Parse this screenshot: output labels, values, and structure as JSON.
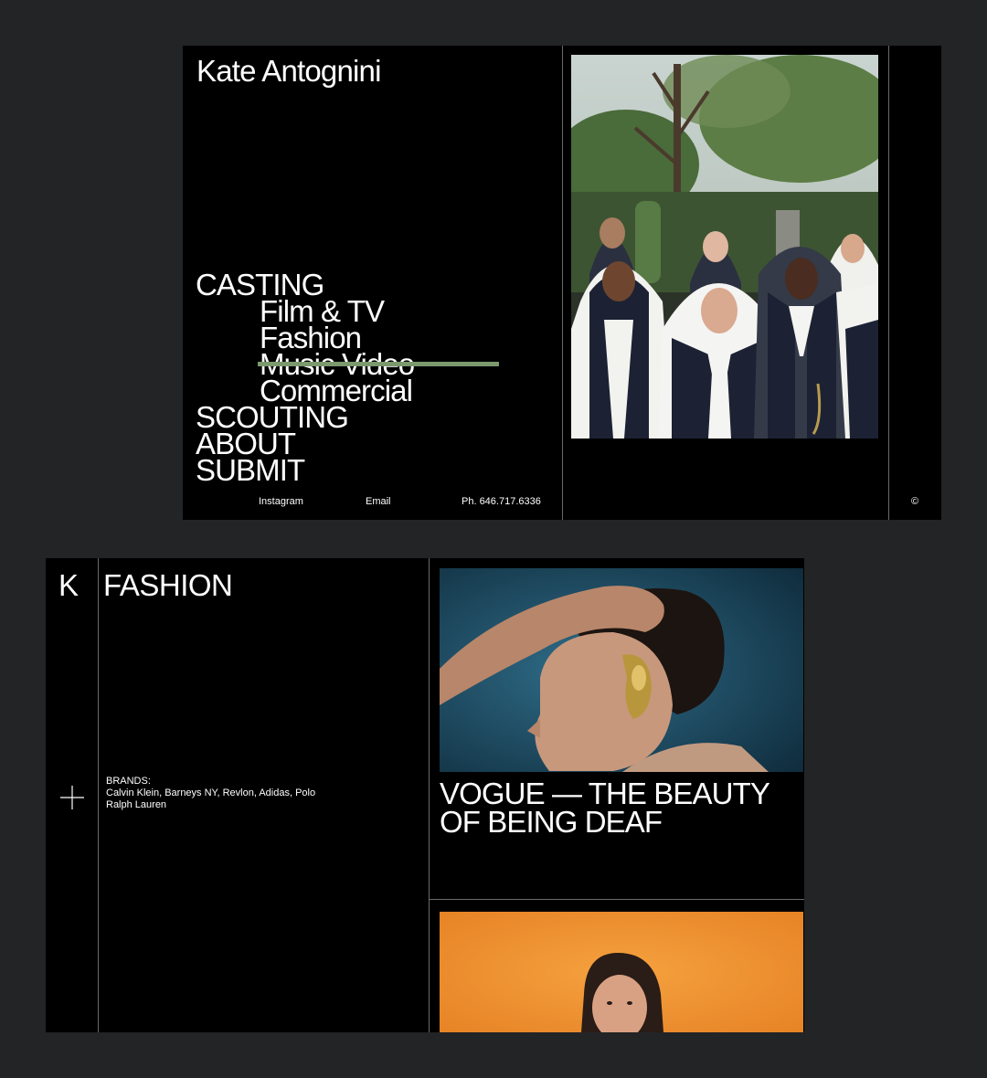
{
  "site": {
    "name": "Kate Antognini",
    "nav": {
      "casting": "CASTING",
      "sub": [
        "Film & TV",
        "Fashion",
        "Music Video",
        "Commercial"
      ],
      "scouting": "SCOUTING",
      "about": "ABOUT",
      "submit": "SUBMIT"
    },
    "footer": {
      "instagram": "Instagram",
      "email": "Email",
      "phone": "Ph. 646.717.6336",
      "copyright": "©"
    }
  },
  "fashion_page": {
    "logo": "K",
    "heading": "FASHION",
    "brands_label": "BRANDS:",
    "brands_list": "Calvin Klein, Barneys NY, Revlon, Adidas, Polo Ralph Lauren",
    "feature_title": "VOGUE — THE BEAUTY OF BEING DEAF"
  },
  "colors": {
    "background": "#232426",
    "panel": "#000000",
    "accent_strike": "#7a9a6e",
    "divider": "#6a6a6a"
  },
  "icons": [
    "plus-icon",
    "copyright-icon"
  ]
}
